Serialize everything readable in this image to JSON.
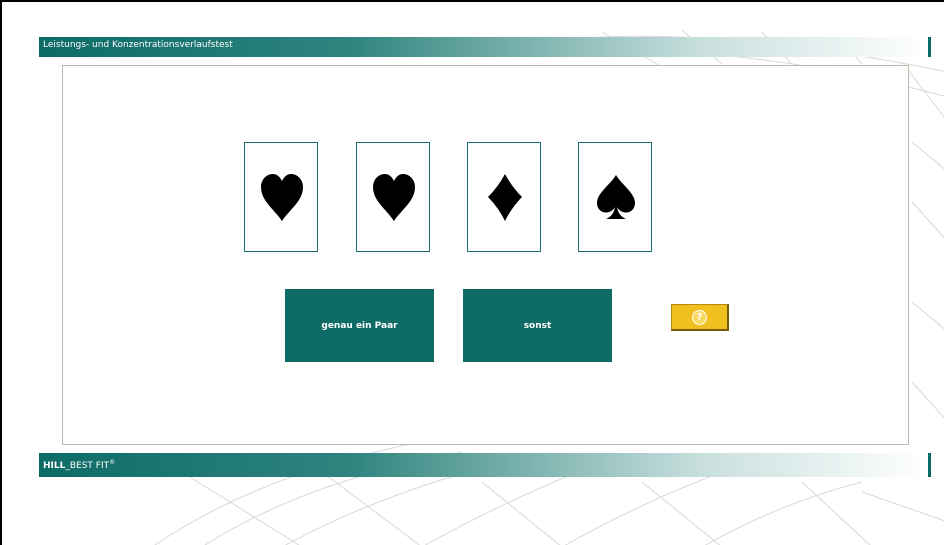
{
  "header": {
    "title": "Leistungs- und Konzentrationsverlaufstest"
  },
  "cards": [
    {
      "suit": "heart-icon"
    },
    {
      "suit": "heart-icon"
    },
    {
      "suit": "diamond-icon"
    },
    {
      "suit": "spade-icon"
    }
  ],
  "buttons": {
    "exactly_one_pair": "genau ein Paar",
    "otherwise": "sonst",
    "help": "?"
  },
  "footer": {
    "brand_bold": "HILL",
    "brand_rest": "_BEST FIT",
    "brand_mark": "®"
  },
  "colors": {
    "accent": "#0f6b66",
    "help": "#f0c020"
  }
}
